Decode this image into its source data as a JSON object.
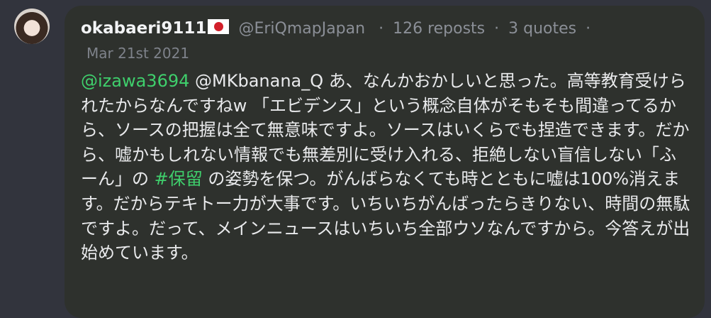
{
  "post": {
    "username": "okabaeri9111",
    "handle": "@EriQmapJapan",
    "reposts": "126 reposts",
    "quotes": "3 quotes",
    "separator": "·",
    "date": "Mar 21st 2021",
    "mention_1": "@izawa3694",
    "mention_2": "@MKbanana_Q",
    "text_part_1": " あ、なんかおかしいと思った。高等教育受けられたからなんですねw 「エビデンス」という概念自体がそもそも間違ってるから、ソースの把握は全て無意味ですよ。ソースはいくらでも捏造できます。だから、嘘かもしれない情報でも無差別に受け入れる、拒絶しない盲信しない「ふーん」の ",
    "hashtag": "#保留",
    "text_part_2": " の姿勢を保つ。がんばらなくても時とともに嘘は100%消えます。だからテキトー力が大事です。いちいちがんばったらきりない、時間の無駄ですよ。だって、メインニュースはいちいち全部ウソなんですから。今答えが出始めています。"
  },
  "colors": {
    "background": "#32343d",
    "card": "#2e312d",
    "link_green": "#3fcf6c",
    "text": "#e9eaec",
    "muted": "#8b8f97"
  },
  "icons": {
    "flag": "japan-flag-icon",
    "avatar": "user-avatar"
  }
}
